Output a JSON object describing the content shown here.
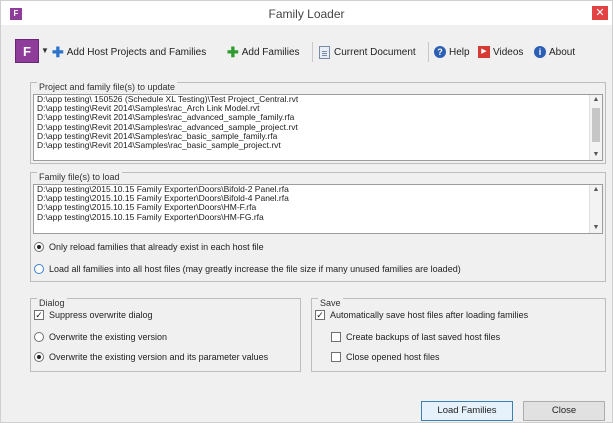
{
  "window": {
    "title": "Family Loader",
    "close_glyph": "✕"
  },
  "toolbar": {
    "brand_letter": "F",
    "items": [
      {
        "label": "Add Host Projects and Families",
        "icon": "plus-blue-icon"
      },
      {
        "label": "Add Families",
        "icon": "plus-green-icon"
      },
      {
        "label": "Current Document",
        "icon": "document-icon"
      },
      {
        "label": "Help",
        "icon": "help-icon"
      },
      {
        "label": "Videos",
        "icon": "videos-icon"
      },
      {
        "label": "About",
        "icon": "info-icon"
      }
    ]
  },
  "projects": {
    "label": "Project and family file(s) to update",
    "items": [
      "D:\\app testing\\ 150526 (Schedule XL Testing)\\Test Project_Central.rvt",
      "D:\\app testing\\Revit 2014\\Samples\\rac_Arch Link Model.rvt",
      "D:\\app testing\\Revit 2014\\Samples\\rac_advanced_sample_family.rfa",
      "D:\\app testing\\Revit 2014\\Samples\\rac_advanced_sample_project.rvt",
      "D:\\app testing\\Revit 2014\\Samples\\rac_basic_sample_family.rfa",
      "D:\\app testing\\Revit 2014\\Samples\\rac_basic_sample_project.rvt"
    ]
  },
  "families": {
    "label": "Family file(s) to load",
    "items": [
      "D:\\app testing\\2015.10.15 Family Exporter\\Doors\\Bifold-2 Panel.rfa",
      "D:\\app testing\\2015.10.15 Family Exporter\\Doors\\Bifold-4 Panel.rfa",
      "D:\\app testing\\2015.10.15 Family Exporter\\Doors\\HM-F.rfa",
      "D:\\app testing\\2015.10.15 Family Exporter\\Doors\\HM-FG.rfa"
    ],
    "options": [
      {
        "label": "Only reload families that already exist in each host file",
        "selected": true
      },
      {
        "label": "Load all families into all host files (may greatly increase the file size if many unused families are loaded)",
        "selected": false
      }
    ]
  },
  "dialog": {
    "label": "Dialog",
    "suppress": {
      "label": "Suppress overwrite dialog",
      "checked": true
    },
    "options": [
      {
        "label": "Overwrite the existing version",
        "selected": false
      },
      {
        "label": "Overwrite the existing version and its parameter values",
        "selected": true
      }
    ]
  },
  "save": {
    "label": "Save",
    "auto_save": {
      "label": "Automatically save host files after loading families",
      "checked": true
    },
    "backups": {
      "label": "Create backups of last saved host files",
      "checked": false
    },
    "close_opened": {
      "label": "Close opened host files",
      "checked": false
    }
  },
  "buttons": {
    "load": "Load Families",
    "close": "Close"
  },
  "colors": {
    "brand": "#8e3d9a",
    "close": "#e24444",
    "accent": "#2b74c9"
  }
}
